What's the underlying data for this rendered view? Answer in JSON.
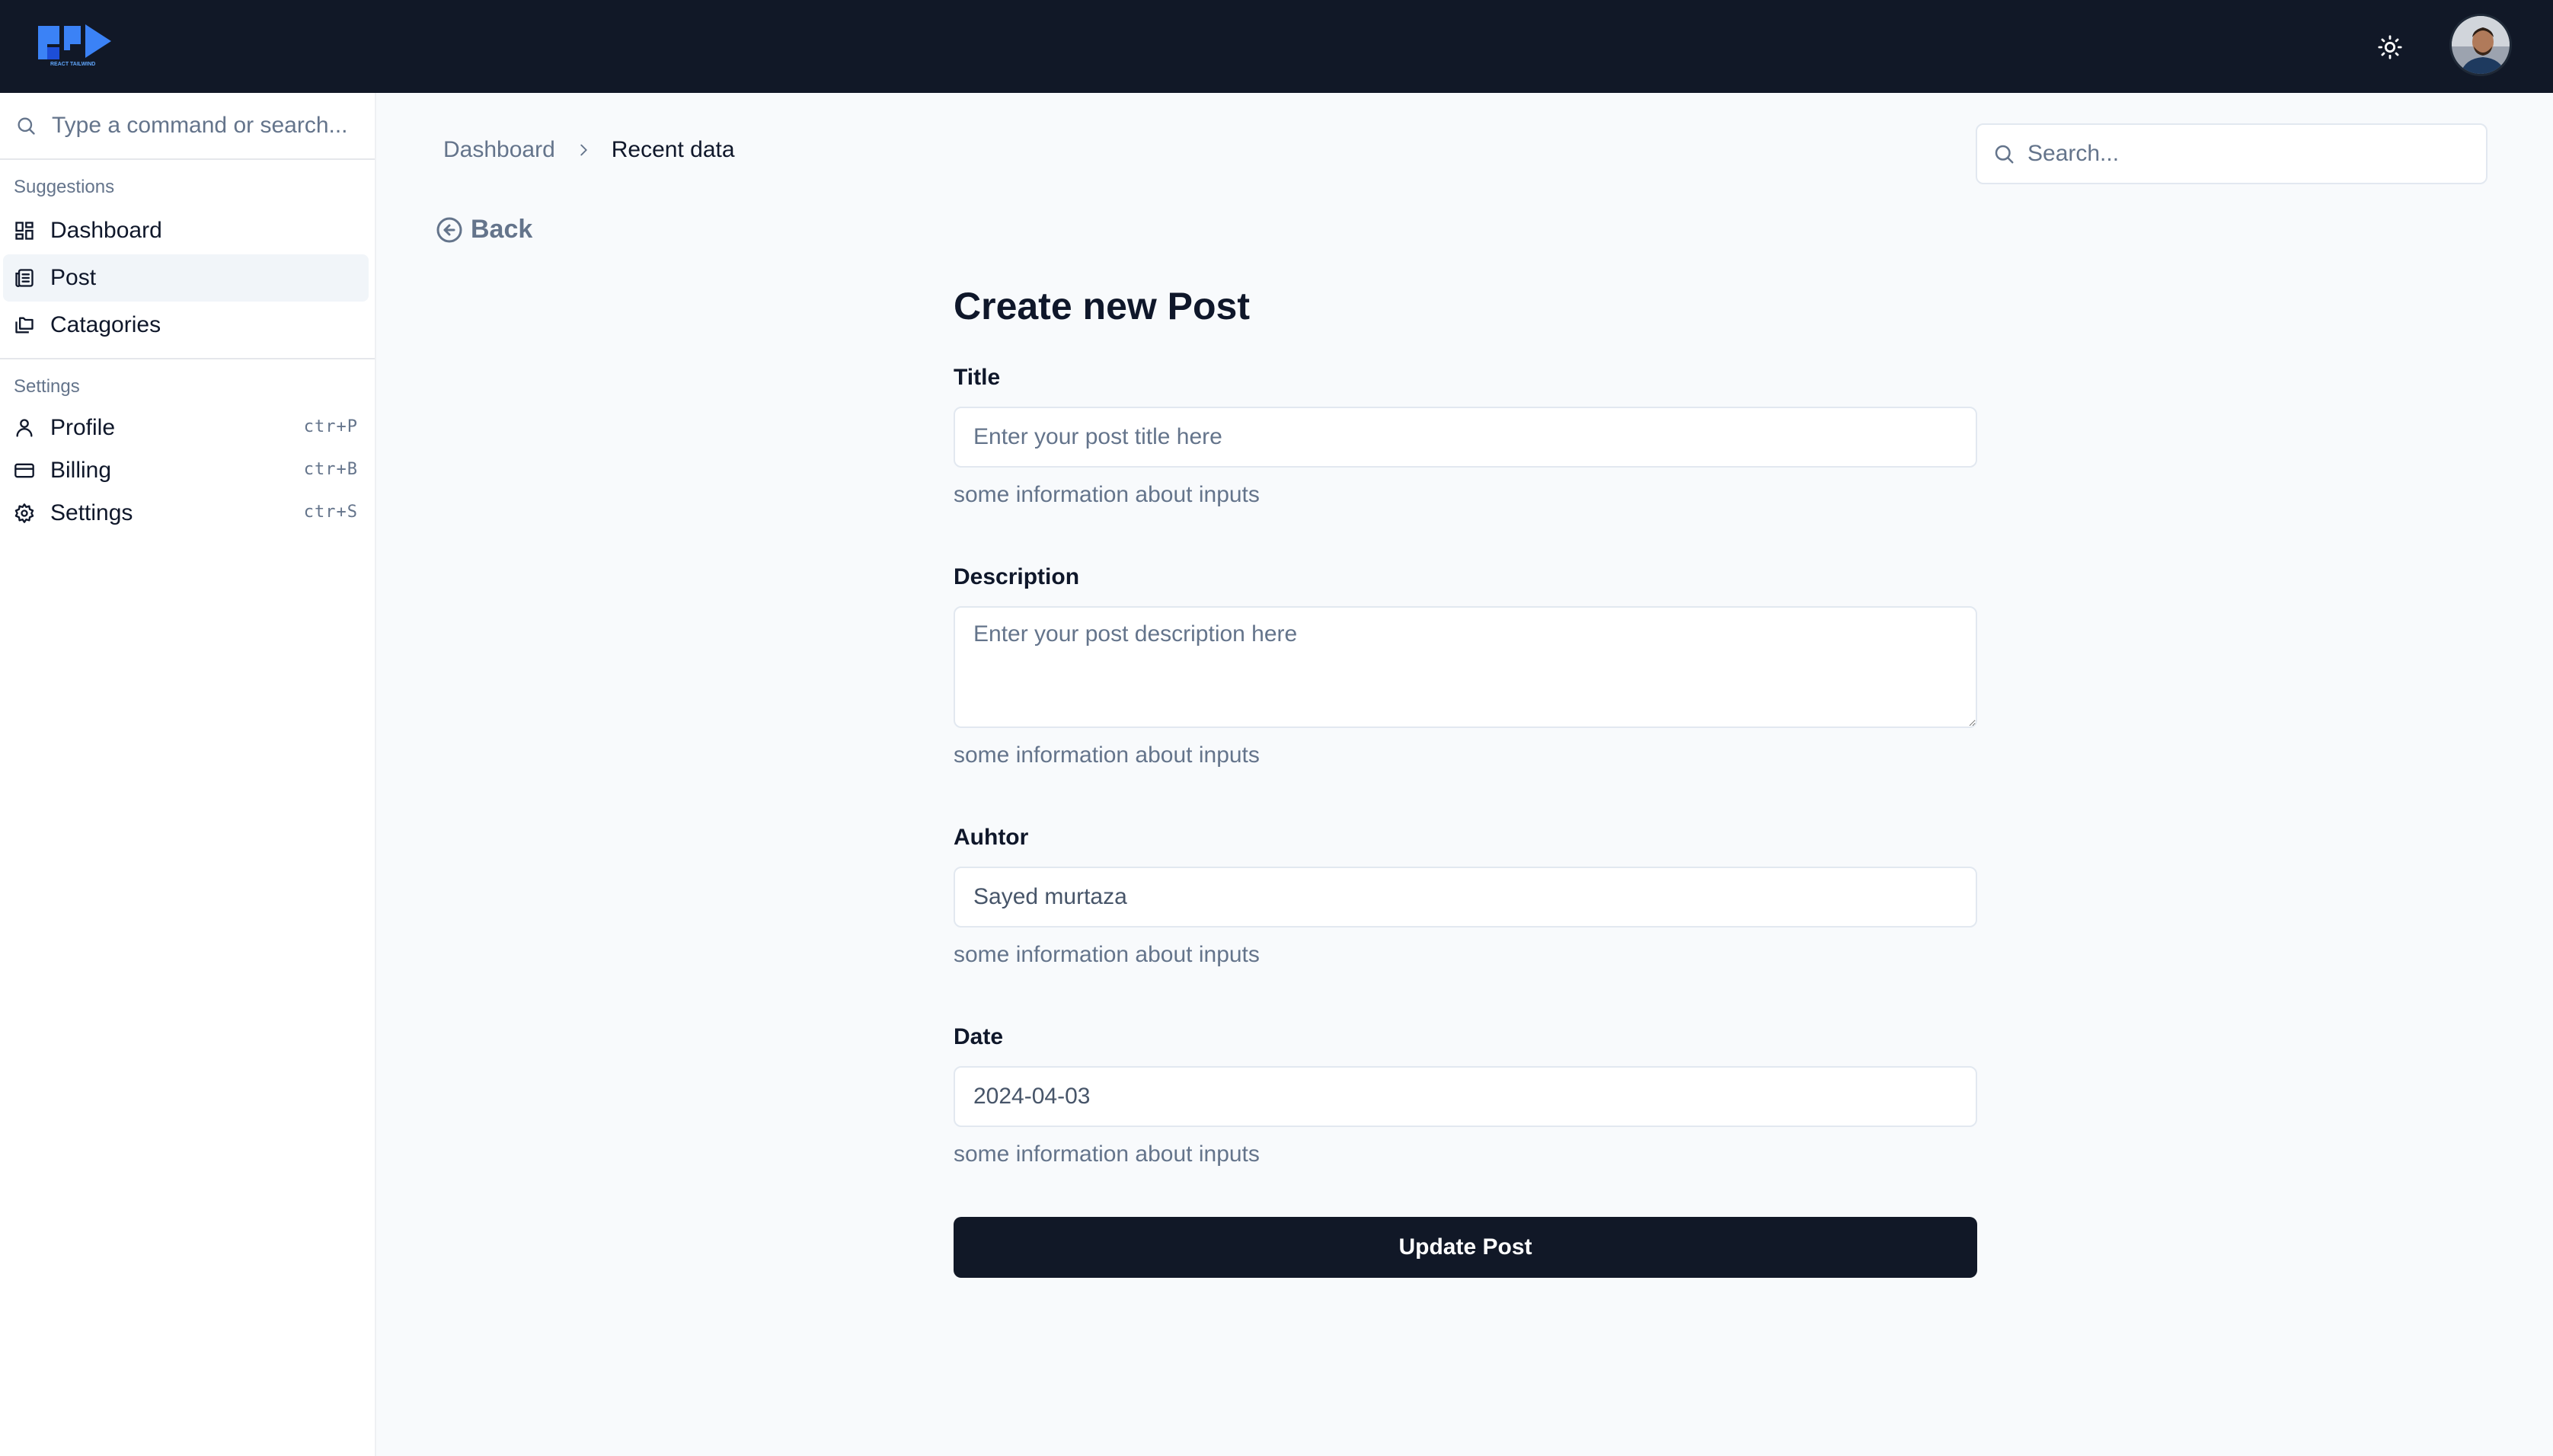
{
  "header": {
    "logo_text": "REACT TAILWIND",
    "theme_icon": "sun-icon",
    "avatar_icon": "user-avatar"
  },
  "sidebar": {
    "command_placeholder": "Type a command or search...",
    "suggestions_title": "Suggestions",
    "suggestions": [
      {
        "label": "Dashboard",
        "icon": "layout-grid-icon"
      },
      {
        "label": "Post",
        "icon": "newspaper-icon"
      },
      {
        "label": "Catagories",
        "icon": "folders-icon"
      }
    ],
    "settings_title": "Settings",
    "settings": [
      {
        "label": "Profile",
        "icon": "user-icon",
        "shortcut": "ctr+P"
      },
      {
        "label": "Billing",
        "icon": "credit-card-icon",
        "shortcut": "ctr+B"
      },
      {
        "label": "Settings",
        "icon": "gear-icon",
        "shortcut": "ctr+S"
      }
    ]
  },
  "breadcrumb": {
    "parent": "Dashboard",
    "current": "Recent data"
  },
  "search": {
    "placeholder": "Search..."
  },
  "back_label": "Back",
  "form": {
    "heading": "Create new Post",
    "title": {
      "label": "Title",
      "placeholder": "Enter your post title here",
      "value": "",
      "help": "some information about inputs"
    },
    "description": {
      "label": "Description",
      "placeholder": "Enter your post description here",
      "value": "",
      "help": "some information about inputs"
    },
    "author": {
      "label": "Auhtor",
      "placeholder": "",
      "value": "Sayed murtaza",
      "help": "some information about inputs"
    },
    "date": {
      "label": "Date",
      "placeholder": "",
      "value": "2024-04-03",
      "help": "some information about inputs"
    },
    "submit_label": "Update Post"
  },
  "colors": {
    "topbar": "#111827",
    "logo": "#3b82f6",
    "page_bg": "#f8fafc",
    "button_bg": "#111827",
    "muted_text": "#64748b"
  }
}
